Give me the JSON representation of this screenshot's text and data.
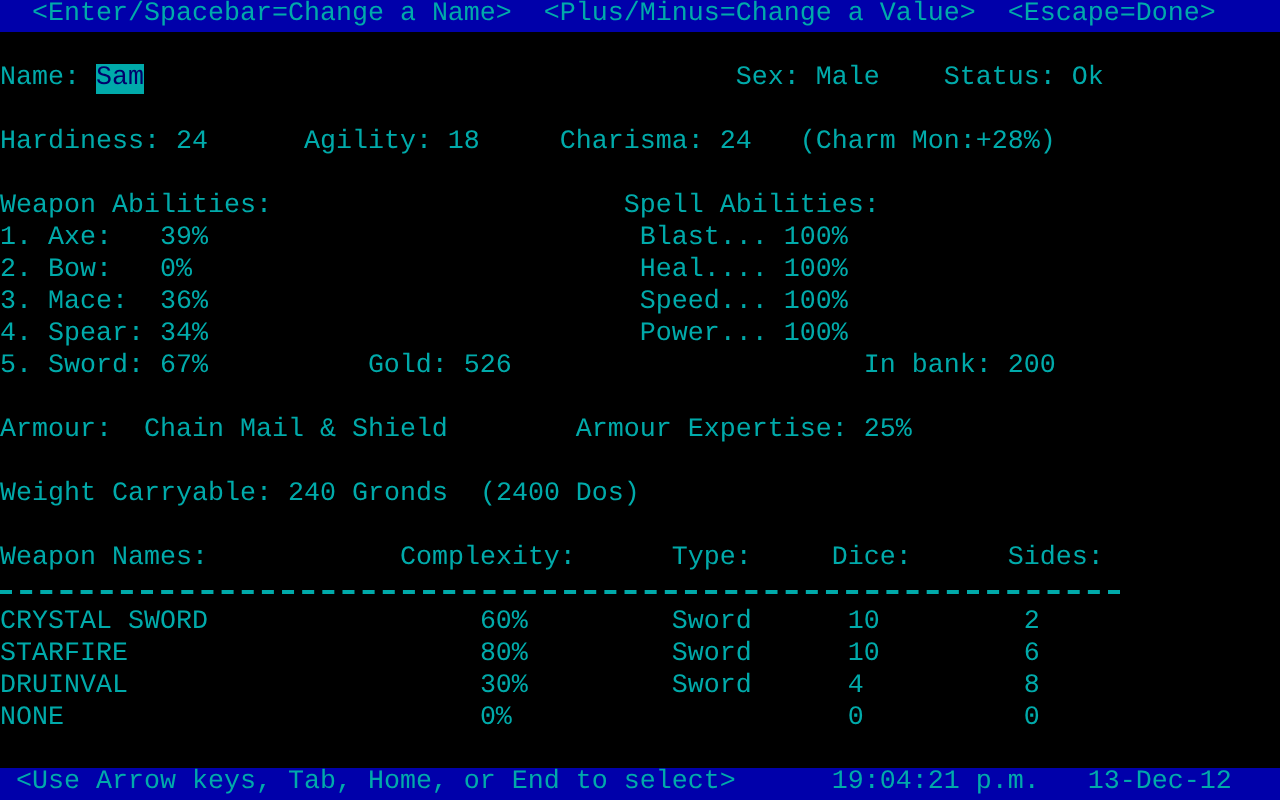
{
  "help_bar": [
    "<Enter/Spacebar=Change a Name>",
    "<Plus/Minus=Change a Value>",
    "<Escape=Done>"
  ],
  "name_field": {
    "label": "Name:",
    "value": "Sam",
    "selected": true
  },
  "sex": "Sex: Male",
  "status": "Status: Ok",
  "attributes": [
    "Hardiness: 24",
    "Agility: 18",
    "Charisma: 24",
    "(Charm Mon:+28%)"
  ],
  "weapon_abilities": {
    "heading": "Weapon Abilities:",
    "items": [
      {
        "label": "1. Axe:",
        "value": "39%"
      },
      {
        "label": "2. Bow:",
        "value": "0%"
      },
      {
        "label": "3. Mace:",
        "value": "36%"
      },
      {
        "label": "4. Spear:",
        "value": "34%"
      },
      {
        "label": "5. Sword:",
        "value": "67%"
      }
    ]
  },
  "spell_abilities": {
    "heading": "Spell Abilities:",
    "items": [
      {
        "label": "Blast...",
        "value": "100%"
      },
      {
        "label": "Heal....",
        "value": "100%"
      },
      {
        "label": "Speed...",
        "value": "100%"
      },
      {
        "label": "Power...",
        "value": "100%"
      }
    ]
  },
  "gold": "Gold: 526",
  "bank": "In bank: 200",
  "armour": {
    "label": "Armour:",
    "value": "Chain Mail & Shield"
  },
  "armour_expertise": "Armour Expertise: 25%",
  "weight": "Weight Carryable: 240 Gronds  (2400 Dos)",
  "weapons_table": {
    "columns": [
      "Weapon Names:",
      "Complexity:",
      "Type:",
      "Dice:",
      "Sides:"
    ],
    "rows": [
      {
        "name": "CRYSTAL SWORD",
        "complexity": "60%",
        "type": "Sword",
        "dice": "10",
        "sides": "2"
      },
      {
        "name": "STARFIRE",
        "complexity": "80%",
        "type": "Sword",
        "dice": "10",
        "sides": "6"
      },
      {
        "name": "DRUINVAL",
        "complexity": "30%",
        "type": "Sword",
        "dice": "4",
        "sides": "8"
      },
      {
        "name": "NONE",
        "complexity": "0%",
        "dice": "0",
        "sides": "0"
      }
    ]
  },
  "status_bar": {
    "hint": "<Use Arrow keys, Tab, Home, or End to select>",
    "time": "19:04:21 p.m.",
    "date": "13-Dec-12"
  }
}
